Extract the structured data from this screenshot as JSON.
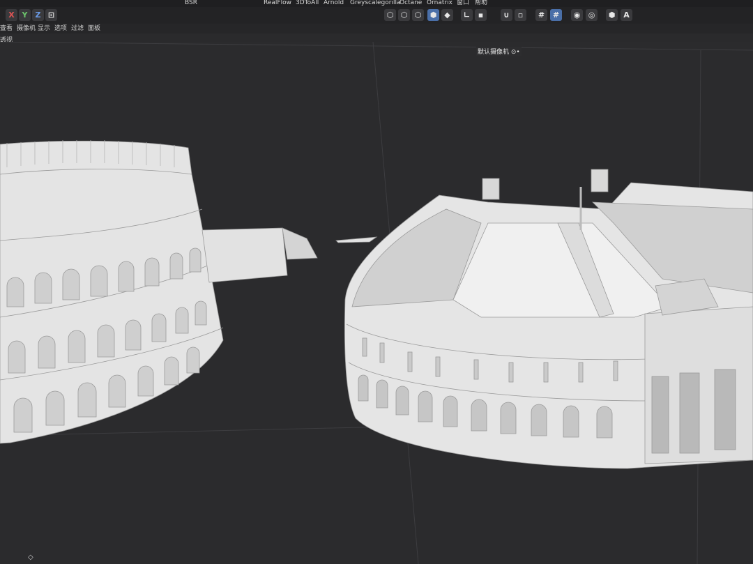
{
  "menubar": {
    "items": [
      "BSR",
      "RealFlow",
      "3DToAll",
      "Arnold",
      "Greyscalegorilla",
      "Octane",
      "Ornatrix",
      "窗口",
      "帮助"
    ]
  },
  "toolbar": {
    "axis_x": "X",
    "axis_y": "Y",
    "axis_z": "Z"
  },
  "viewmenu": {
    "items": [
      "查看",
      "摄像机",
      "显示",
      "选项",
      "过滤",
      "面板"
    ]
  },
  "viewport": {
    "corner_label": "透视",
    "camera_label": "默认摄像机 ⊙•",
    "background_color": "#2b2b2d",
    "model_color": "#e6e6e6"
  }
}
